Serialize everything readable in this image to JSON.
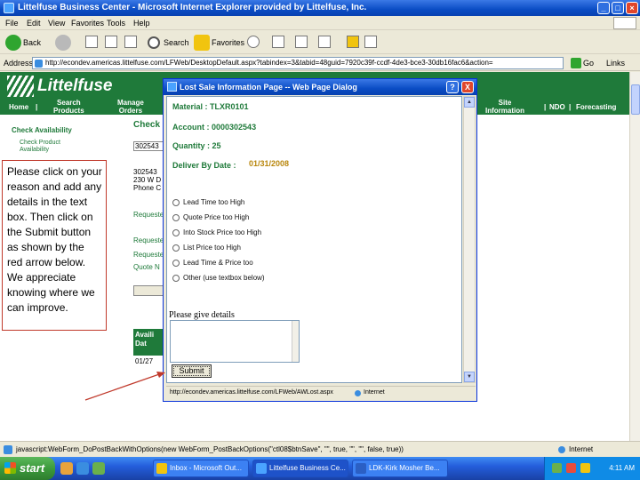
{
  "window": {
    "title": "Littelfuse Business Center - Microsoft Internet Explorer provided by Littelfuse, Inc."
  },
  "menu": [
    "File",
    "Edit",
    "View",
    "Favorites",
    "Tools",
    "Help"
  ],
  "toolbar": {
    "back_label": "Back",
    "search_label": "Search",
    "favorites_label": "Favorites"
  },
  "address": {
    "label": "Address",
    "url": "http://econdev.americas.littelfuse.com/LFWeb/DesktopDefault.aspx?tabindex=3&tabid=48guid=7920c39f-ccdf-4de3-bce3-30db16fac6&action=",
    "go_label": "Go",
    "links_label": "Links"
  },
  "site": {
    "logo_text": "Littelfuse",
    "nav": [
      {
        "label": "Home"
      },
      {
        "label": "Search\nProducts"
      },
      {
        "label": "Manage\nOrders"
      },
      {
        "label": "Site\nInformation"
      },
      {
        "label": "NDO"
      },
      {
        "label": "Forecasting"
      }
    ],
    "side_heading": "Check Availability",
    "side_sub": "Check Product\nAvailability",
    "main_heading_partial": "Check",
    "snippets": {
      "acct_partial": "302543",
      "addr1": "302543",
      "addr2": "230 W D",
      "addr3": "Phone C",
      "req1": "Requeste",
      "req2": "Requeste",
      "req3": "Requeste",
      "quote": "Quote N",
      "avail_hdr": "Availi\nDat",
      "date_partial": "01/27"
    }
  },
  "instructions": "Please click on your reason and add any details in the text box. Then click on the Submit button as shown by the red arrow below. We appreciate knowing where we can improve.",
  "dialog": {
    "title": "Lost Sale Information Page -- Web Page Dialog",
    "help_btn": "?",
    "close_btn": "X",
    "material_label": "Material :",
    "material_value": "TLXR0101",
    "account_label": "Account :",
    "account_value": "0000302543",
    "quantity_label": "Quantity :",
    "quantity_value": "25",
    "deliver_label": "Deliver By Date :",
    "deliver_value": "01/31/2008",
    "reasons": [
      "Lead Time too High",
      "Quote Price too High",
      "Into Stock Price too High",
      "List Price too High",
      "Lead Time & Price too",
      "Other (use textbox below)"
    ],
    "details_label": "Please give details",
    "submit_label": "Submit",
    "status_url": "http://econdev.americas.littelfuse.com/LFWeb/AWLost.aspx",
    "status_zone": "Internet"
  },
  "statusbar": {
    "text": "javascript:WebForm_DoPostBackWithOptions(new WebForm_PostBackOptions(\"ctl08$btnSave\", \"\", true, \"\", \"\", false, true))",
    "zone": "Internet"
  },
  "taskbar": {
    "start_label": "start",
    "items": [
      {
        "label": "Inbox - Microsoft Out..."
      },
      {
        "label": "Littelfuse Business Ce..."
      },
      {
        "label": "LDK-Kirk Mosher Be..."
      }
    ],
    "clock": "4:11 AM"
  },
  "colors": {
    "brand_green": "#1f7a3a",
    "xp_blue": "#0a4cc4",
    "arrow_red": "#c0392b"
  }
}
